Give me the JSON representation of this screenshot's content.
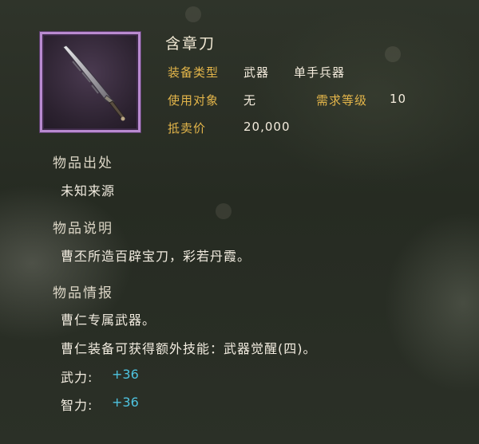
{
  "item": {
    "name": "含章刀",
    "type_label": "装备类型",
    "type_value": "武器",
    "subtype_value": "单手兵器",
    "target_label": "使用对象",
    "target_value": "无",
    "level_label": "需求等级",
    "level_value": "10",
    "price_label": "抵卖价",
    "price_value": "20,000",
    "icon": "sword-icon"
  },
  "sections": {
    "origin_title": "物品出处",
    "origin_text": "未知来源",
    "desc_title": "物品说明",
    "desc_text": "曹丕所造百辟宝刀，彩若丹霞。",
    "info_title": "物品情报",
    "info_line1": "曹仁专属武器。",
    "info_line2": "曹仁装备可获得额外技能：武器觉醒(四)。"
  },
  "stats": [
    {
      "label": "武力:",
      "value": "+36"
    },
    {
      "label": "智力:",
      "value": "+36"
    }
  ],
  "colors": {
    "label_gold": "#e3b54a",
    "stat_cyan": "#4ec3e0",
    "frame_purple": "#b98ad0"
  }
}
